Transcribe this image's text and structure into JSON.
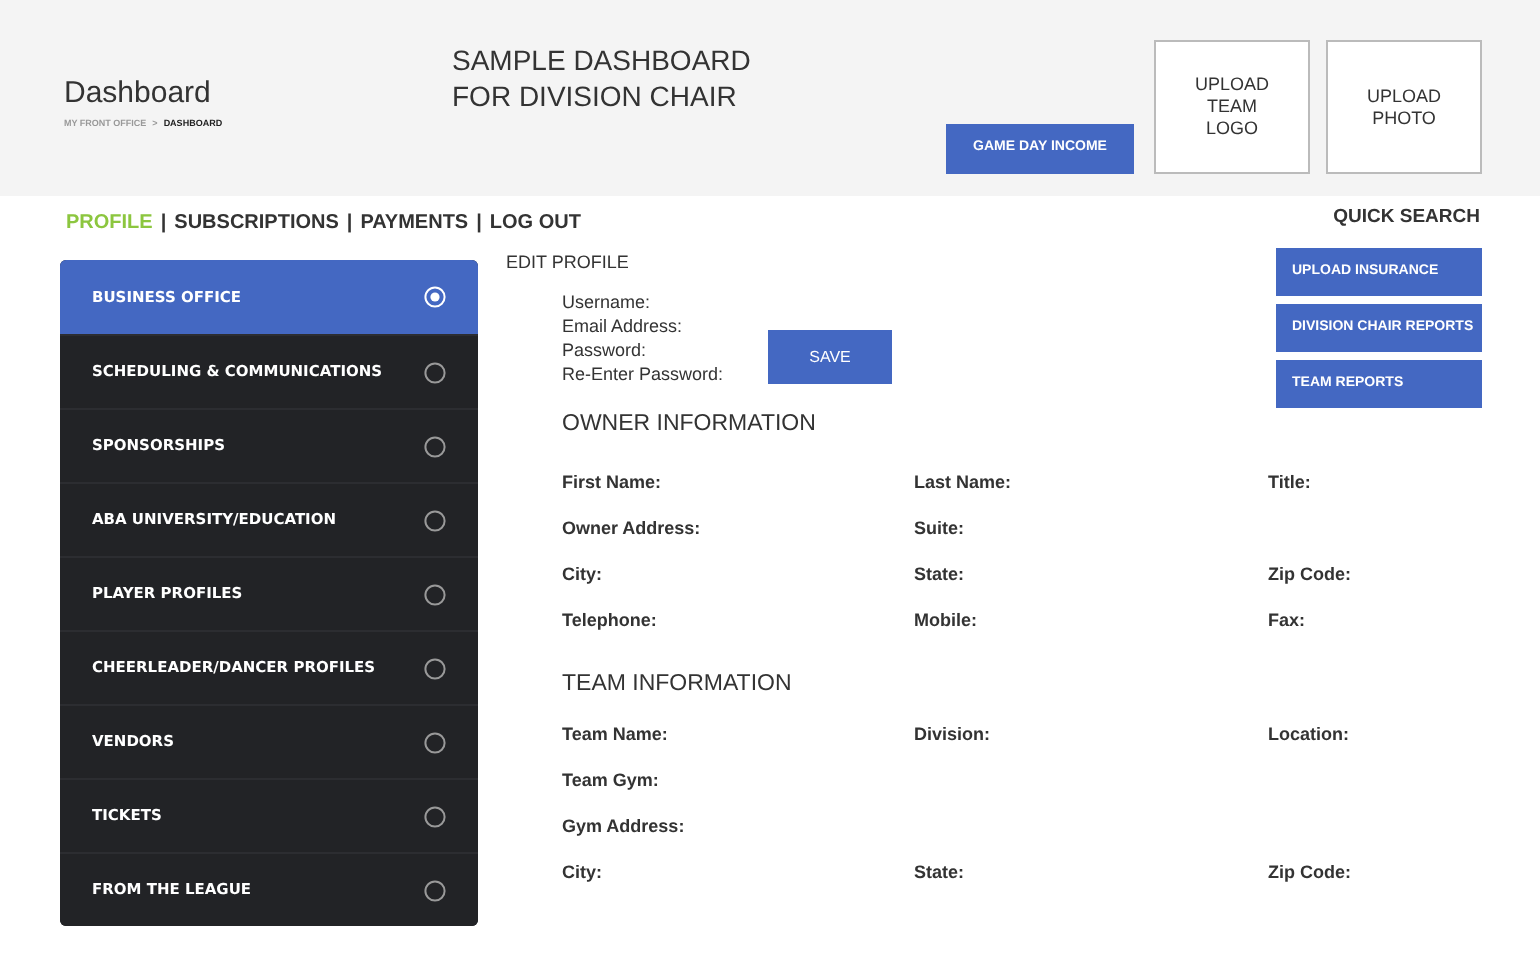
{
  "header": {
    "title": "Dashboard",
    "breadcrumb": [
      "MY FRONT OFFICE",
      ">",
      "DASHBOARD"
    ],
    "heading": "SAMPLE DASHBOARD FOR DIVISION CHAIR",
    "income_button": "GAME DAY INCOME",
    "upload_boxes": [
      "UPLOAD TEAM LOGO",
      "UPLOAD PHOTO"
    ]
  },
  "nav": [
    {
      "label": "PROFILE",
      "kind": "link",
      "selected": true
    },
    {
      "label": "|",
      "kind": "separator"
    },
    {
      "label": "SUBSCRIPTIONS",
      "kind": "link",
      "selected": false
    },
    {
      "label": "|",
      "kind": "separator"
    },
    {
      "label": "PAYMENTS",
      "kind": "link",
      "selected": false
    },
    {
      "label": "|",
      "kind": "separator"
    },
    {
      "label": "LOG OUT",
      "kind": "link",
      "selected": false
    }
  ],
  "quick_search": "QUICK SEARCH",
  "sidebar": {
    "items": [
      {
        "label": "BUSINESS OFFICE",
        "selected": true
      },
      {
        "label": "SCHEDULING & COMMUNICATIONS",
        "selected": false
      },
      {
        "label": "SPONSORSHIPS",
        "selected": false
      },
      {
        "label": "ABA UNIVERSITY/EDUCATION",
        "selected": false
      },
      {
        "label": "PLAYER PROFILES",
        "selected": false
      },
      {
        "label": "CHEERLEADER/DANCER PROFILES",
        "selected": false
      },
      {
        "label": "VENDORS",
        "selected": false
      },
      {
        "label": "TICKETS",
        "selected": false
      },
      {
        "label": "FROM THE LEAGUE",
        "selected": false
      }
    ]
  },
  "edit_profile": {
    "title": "EDIT PROFILE",
    "fields": [
      "Username:",
      "Email Address:",
      "Password:",
      "Re-Enter Password:"
    ],
    "save_button": "SAVE"
  },
  "side_buttons": [
    "UPLOAD INSURANCE",
    "DIVISION CHAIR REPORTS",
    "TEAM REPORTS"
  ],
  "sections": [
    {
      "title": "OWNER INFORMATION",
      "rows": [
        [
          "First Name:",
          "Last Name:",
          "Title:"
        ],
        [
          "Owner Address:",
          "Suite:"
        ],
        [
          "City:",
          "State:",
          "Zip Code:"
        ],
        [
          "Telephone:",
          "Mobile:",
          "Fax:"
        ]
      ]
    },
    {
      "title": "TEAM INFORMATION",
      "rows": [
        [
          "Team Name:",
          "Division:",
          "Location:"
        ],
        [
          "Team Gym:"
        ],
        [
          "Gym Address:"
        ],
        [
          "City:",
          "State:",
          "Zip Code:"
        ]
      ]
    }
  ]
}
